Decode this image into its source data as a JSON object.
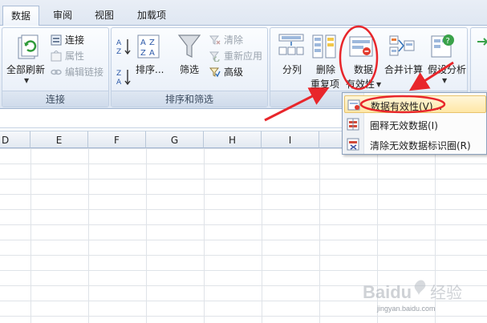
{
  "tabs": [
    "数据",
    "审阅",
    "视图",
    "加载项"
  ],
  "groups": {
    "connections": {
      "label": "连接",
      "refresh_all": "全部刷新",
      "connections": "连接",
      "properties": "属性",
      "edit_links": "编辑链接"
    },
    "sort_filter": {
      "label": "排序和筛选",
      "sort": "排序...",
      "filter": "筛选",
      "clear": "清除",
      "reapply": "重新应用",
      "advanced": "高级"
    },
    "data_tools": {
      "text_to_columns": "分列",
      "remove_dup_line1": "删除",
      "remove_dup_line2": "重复项",
      "validation_line1": "数据",
      "validation_line2": "有效性",
      "consolidate": "合并计算",
      "what_if": "假设分析"
    }
  },
  "columns": [
    "D",
    "E",
    "F",
    "G",
    "H",
    "I"
  ],
  "validation_menu": [
    {
      "label": "数据有效性(V)...",
      "highlighted": true
    },
    {
      "label": "圈释无效数据(I)",
      "highlighted": false
    },
    {
      "label": "清除无效数据标识圈(R)",
      "highlighted": false
    }
  ],
  "watermark": {
    "url": "jingyan.baidu.com"
  },
  "colors": {
    "annotation_red": "#e8262b",
    "ribbon_border": "#9fb3cf",
    "menu_highlight": "#ffe7a6"
  }
}
